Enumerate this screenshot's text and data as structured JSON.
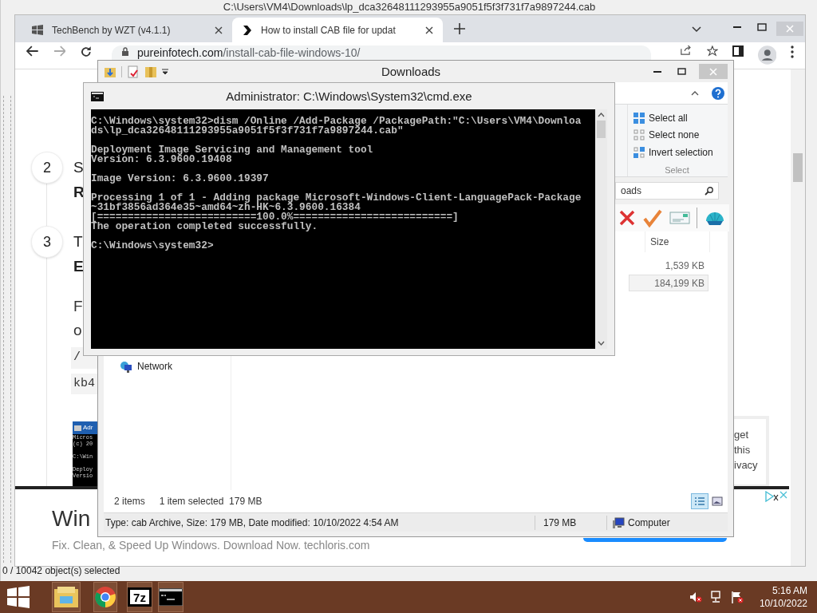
{
  "background_window": {
    "title": "C:\\Users\\VM4\\Downloads\\lp_dca32648111293955a9051f5f3f731f7a9897244.cab",
    "status": "0 / 10042 object(s) selected"
  },
  "browser": {
    "tabs": [
      {
        "title": "TechBench by WZT (v4.1.1)",
        "kind": "windows",
        "selected": false
      },
      {
        "title": "How to install CAB file for updat",
        "kind": "chevron",
        "selected": true
      }
    ],
    "url_host": "pureinfotech.com",
    "url_path": "/install-cab-file-windows-10/",
    "steps": [
      {
        "number": "2",
        "lines": [
          "S",
          "R"
        ]
      },
      {
        "number": "3",
        "lines": [
          "T",
          "E"
        ]
      }
    ],
    "paragraph_lines": [
      "F",
      "o"
    ],
    "code_lines": [
      "/",
      "kb4"
    ],
    "embedded_screenshot": {
      "title": "Adr",
      "blocks": [
        [
          "Micros",
          "(c) 20"
        ],
        [
          "C:\\Win"
        ],
        [
          "Deploy",
          "Versio"
        ]
      ]
    },
    "popup_lines": [
      "get",
      "this",
      "ivacy"
    ],
    "ad": {
      "headline": "Win",
      "text": "Fix. Clean, & Speed Up Windows. Download Now. techloris.com"
    }
  },
  "explorer": {
    "title": "Downloads",
    "select_actions": [
      {
        "label": "Select all",
        "kind": "all"
      },
      {
        "label": "Select none",
        "kind": "none"
      },
      {
        "label": "Invert selection",
        "kind": "invert"
      }
    ],
    "select_group": "Select",
    "search_value": "oads",
    "size_column": "Size",
    "rows": [
      {
        "size": "1,539 KB",
        "selected": false
      },
      {
        "size": "184,199 KB",
        "selected": true
      }
    ],
    "nav_items": [
      "Network"
    ],
    "item_count": "2 items",
    "selection_info": "1 item selected  179 MB",
    "details": {
      "summary": "Type: cab Archive, Size: 179 MB, Date modified: 10/10/2022 4:54 AM",
      "size": "179 MB",
      "zone": "Computer"
    }
  },
  "console": {
    "title": "Administrator: C:\\Windows\\System32\\cmd.exe",
    "blocks": [
      [
        "C:\\Windows\\system32>dism /Online /Add-Package /PackagePath:\"C:\\Users\\VM4\\Downloa",
        "ds\\lp_dca32648111293955a9051f5f3f731f7a9897244.cab\""
      ],
      [
        "Deployment Image Servicing and Management tool",
        "Version: 6.3.9600.19408"
      ],
      [
        "Image Version: 6.3.9600.19397"
      ],
      [
        "Processing 1 of 1 - Adding package Microsoft-Windows-Client-LanguagePack-Package",
        "~31bf3856ad364e35~amd64~zh-HK~6.3.9600.16384",
        "[==========================100.0%==========================]",
        "The operation completed successfully."
      ],
      [
        "C:\\Windows\\system32>"
      ]
    ]
  },
  "taskbar": {
    "apps": [
      {
        "kind": "explorer"
      },
      {
        "kind": "chrome"
      },
      {
        "kind": "sevenzip",
        "label": "7z"
      },
      {
        "kind": "console"
      }
    ],
    "time": "5:16 AM",
    "date": "10/10/2022"
  }
}
